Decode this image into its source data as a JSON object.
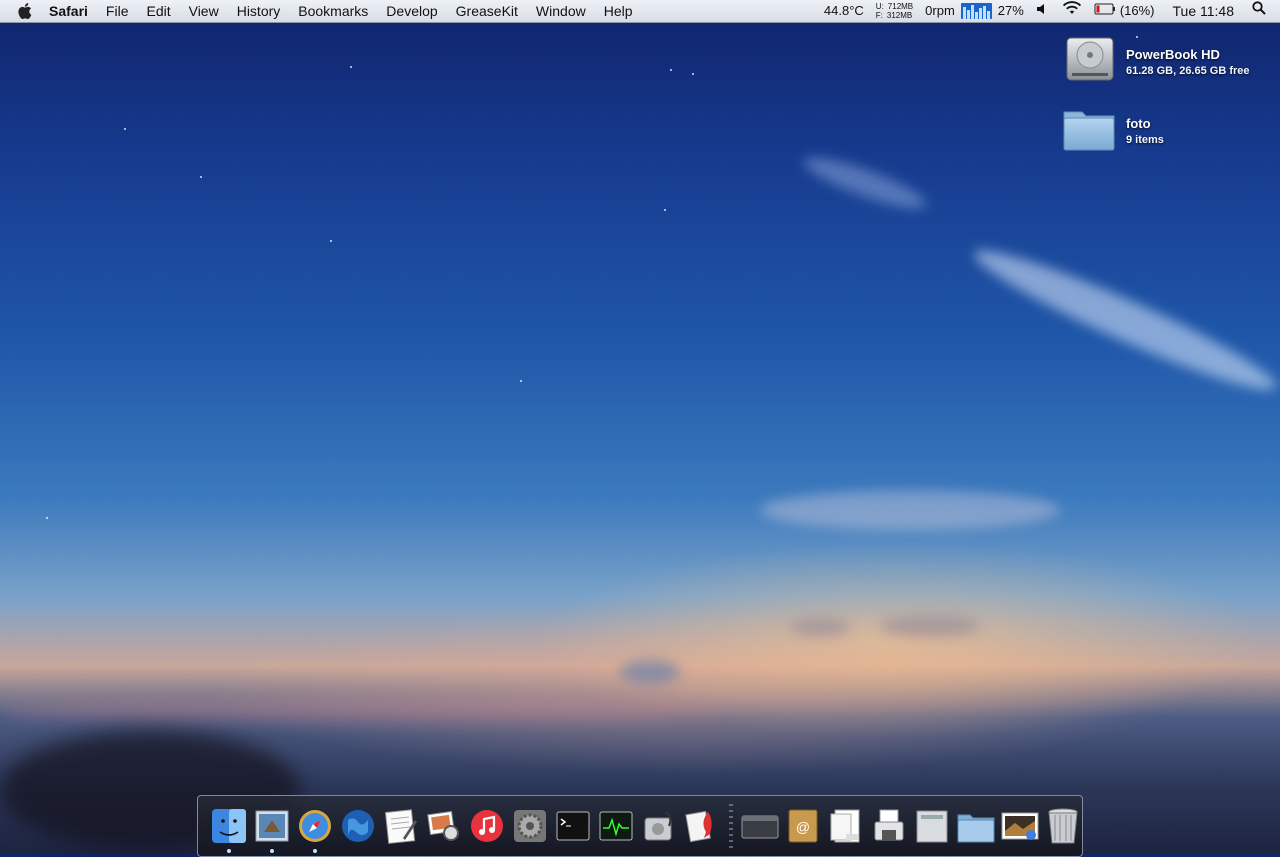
{
  "menubar": {
    "app_name": "Safari",
    "menus": [
      "File",
      "Edit",
      "View",
      "History",
      "Bookmarks",
      "Develop",
      "GreaseKit",
      "Window",
      "Help"
    ],
    "temperature": "44.8°C",
    "memory": {
      "used_label": "U:",
      "used": "712MB",
      "free_label": "F:",
      "free": "312MB"
    },
    "fan": "0rpm",
    "cpu_percent": "27%",
    "battery": "(16%)",
    "clock": "Tue 11:48",
    "icons": [
      "apple-icon",
      "volume-icon",
      "wifi-icon",
      "battery-icon",
      "spotlight-icon"
    ]
  },
  "desktop": {
    "items": [
      {
        "name": "PowerBook HD",
        "info": "61.28 GB, 26.65 GB free",
        "icon": "hard-drive-icon"
      },
      {
        "name": "foto",
        "info": "9 items",
        "icon": "folder-icon"
      }
    ]
  },
  "dock": {
    "apps": [
      {
        "icon": "finder-icon",
        "running": true
      },
      {
        "icon": "mail-icon",
        "running": true
      },
      {
        "icon": "safari-icon",
        "running": true
      },
      {
        "icon": "network-globe-icon",
        "running": false
      },
      {
        "icon": "textedit-icon",
        "running": false
      },
      {
        "icon": "preview-icon",
        "running": false
      },
      {
        "icon": "itunes-icon",
        "running": false
      },
      {
        "icon": "system-preferences-icon",
        "running": false
      },
      {
        "icon": "terminal-icon",
        "running": false
      },
      {
        "icon": "activity-monitor-icon",
        "running": false
      },
      {
        "icon": "disk-utility-icon",
        "running": false
      },
      {
        "icon": "script-rocket-icon",
        "running": false
      }
    ],
    "stacks": [
      {
        "icon": "window-stack-icon"
      },
      {
        "icon": "address-book-icon"
      },
      {
        "icon": "pdf-document-icon"
      },
      {
        "icon": "printer-icon"
      },
      {
        "icon": "documents-stack-icon"
      },
      {
        "icon": "folder-stack-icon"
      },
      {
        "icon": "photo-stack-icon"
      },
      {
        "icon": "trash-icon"
      }
    ]
  }
}
